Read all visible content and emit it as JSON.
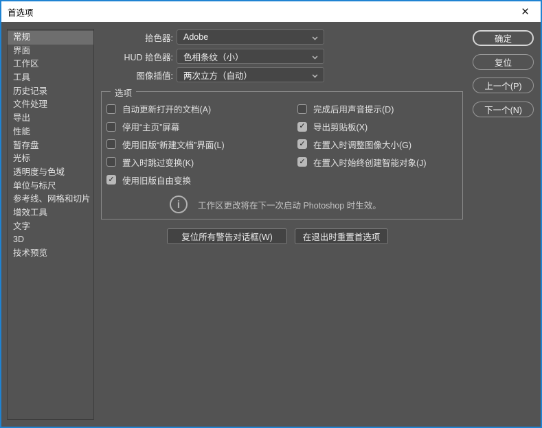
{
  "window": {
    "title": "首选项"
  },
  "icons": {
    "close": "×",
    "check": "✓",
    "info": "i"
  },
  "sidebar": {
    "items": [
      {
        "label": "常规",
        "selected": true
      },
      {
        "label": "界面",
        "selected": false
      },
      {
        "label": "工作区",
        "selected": false
      },
      {
        "label": "工具",
        "selected": false
      },
      {
        "label": "历史记录",
        "selected": false
      },
      {
        "label": "文件处理",
        "selected": false
      },
      {
        "label": "导出",
        "selected": false
      },
      {
        "label": "性能",
        "selected": false
      },
      {
        "label": "暂存盘",
        "selected": false
      },
      {
        "label": "光标",
        "selected": false
      },
      {
        "label": "透明度与色域",
        "selected": false
      },
      {
        "label": "单位与标尺",
        "selected": false
      },
      {
        "label": "参考线、网格和切片",
        "selected": false
      },
      {
        "label": "增效工具",
        "selected": false
      },
      {
        "label": "文字",
        "selected": false
      },
      {
        "label": "3D",
        "selected": false
      },
      {
        "label": "技术预览",
        "selected": false
      }
    ]
  },
  "pickers": [
    {
      "label": "拾色器:",
      "value": "Adobe"
    },
    {
      "label": "HUD 拾色器:",
      "value": "色相条纹（小）"
    },
    {
      "label": "图像插值:",
      "value": "两次立方（自动）"
    }
  ],
  "options": {
    "title": "选项",
    "left": [
      {
        "label": "自动更新打开的文档(A)",
        "checked": false
      },
      {
        "label": "停用“主页”屏幕",
        "checked": false
      },
      {
        "label": "使用旧版“新建文档”界面(L)",
        "checked": false
      },
      {
        "label": "置入时跳过变换(K)",
        "checked": false
      },
      {
        "label": "使用旧版自由变换",
        "checked": true
      }
    ],
    "right": [
      {
        "label": "完成后用声音提示(D)",
        "checked": false
      },
      {
        "label": "导出剪贴板(X)",
        "checked": true
      },
      {
        "label": "在置入时调整图像大小(G)",
        "checked": true
      },
      {
        "label": "在置入时始终创建智能对象(J)",
        "checked": true
      }
    ],
    "info": "工作区更改将在下一次启动 Photoshop 时生效。"
  },
  "footer_buttons": [
    {
      "label": "复位所有警告对话框(W)"
    },
    {
      "label": "在退出时重置首选项"
    }
  ],
  "side_buttons": [
    {
      "label": "确定",
      "default": true
    },
    {
      "label": "复位",
      "default": false
    },
    {
      "label": "上一个(P)",
      "default": false
    },
    {
      "label": "下一个(N)",
      "default": false
    }
  ],
  "colors": {
    "accent_border": "#1f83d2",
    "dialog_bg": "#535353",
    "titlebar_bg": "#ffffff",
    "text": "#e2e2e2",
    "checked_bg": "#b9b9b9"
  }
}
